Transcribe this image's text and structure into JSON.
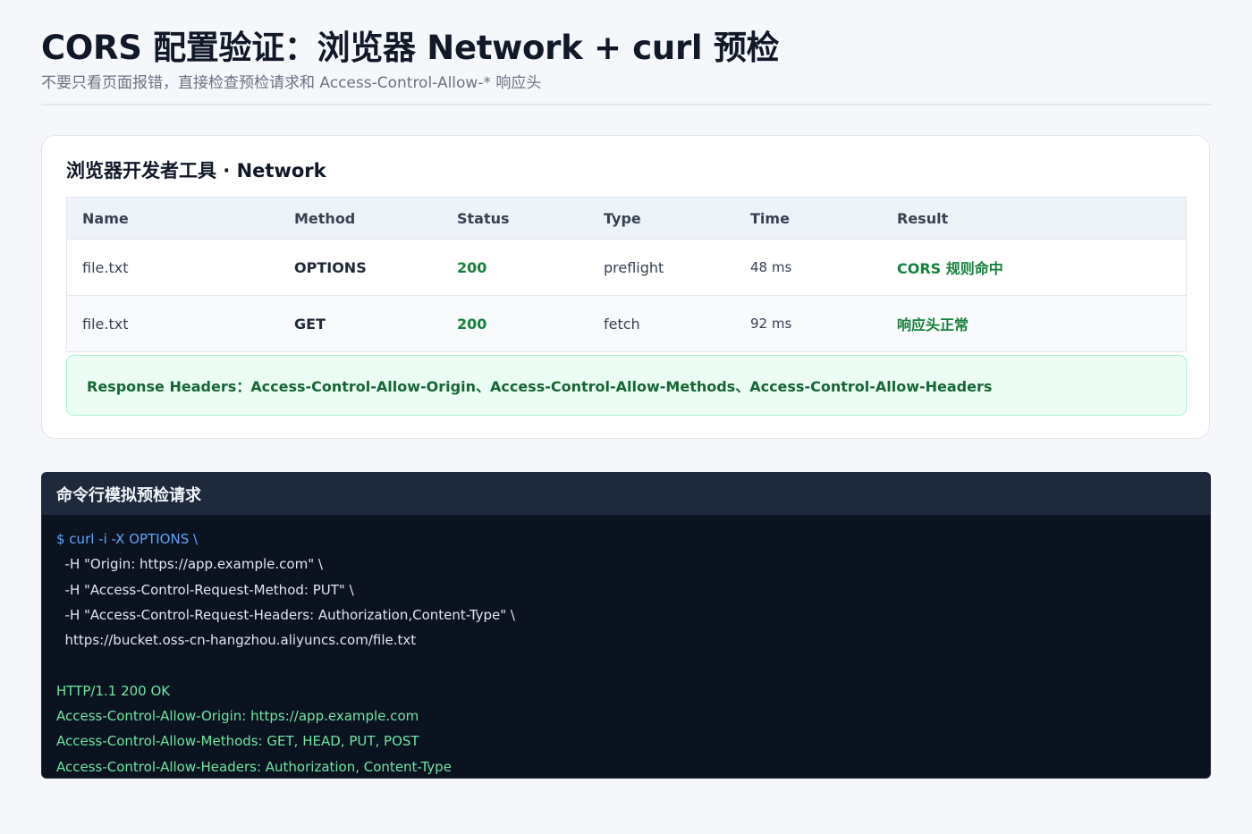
{
  "header": {
    "title": "CORS 配置验证：浏览器 Network + curl 预检",
    "subtitle": "不要只看页面报错，直接检查预检请求和 Access-Control-Allow-* 响应头"
  },
  "network": {
    "title": "浏览器开发者工具 · Network",
    "columns": [
      "Name",
      "Method",
      "Status",
      "Type",
      "Time",
      "Result"
    ],
    "rows": [
      {
        "name": "file.txt",
        "method": "OPTIONS",
        "status": "200",
        "type": "preflight",
        "time": "48 ms",
        "result": "CORS 规则命中"
      },
      {
        "name": "file.txt",
        "method": "GET",
        "status": "200",
        "type": "fetch",
        "time": "92 ms",
        "result": "响应头正常"
      }
    ],
    "response_headers": "Response Headers：Access-Control-Allow-Origin、Access-Control-Allow-Methods、Access-Control-Allow-Headers"
  },
  "terminal": {
    "title": "命令行模拟预检请求",
    "lines": [
      {
        "text": "$ curl -i -X OPTIONS \\",
        "kind": "cmd"
      },
      {
        "text": "  -H \"Origin: https://app.example.com\" \\",
        "kind": "plain"
      },
      {
        "text": "  -H \"Access-Control-Request-Method: PUT\" \\",
        "kind": "plain"
      },
      {
        "text": "  -H \"Access-Control-Request-Headers: Authorization,Content-Type\" \\",
        "kind": "plain"
      },
      {
        "text": "  https://bucket.oss-cn-hangzhou.aliyuncs.com/file.txt",
        "kind": "plain"
      },
      {
        "text": "",
        "kind": "plain"
      },
      {
        "text": "HTTP/1.1 200 OK",
        "kind": "ok"
      },
      {
        "text": "Access-Control-Allow-Origin: https://app.example.com",
        "kind": "ok"
      },
      {
        "text": "Access-Control-Allow-Methods: GET, HEAD, PUT, POST",
        "kind": "ok"
      },
      {
        "text": "Access-Control-Allow-Headers: Authorization, Content-Type",
        "kind": "ok"
      }
    ]
  },
  "colors": {
    "success": "#15803d",
    "command": "#60a5fa",
    "terminal_bg": "#0b1220"
  }
}
